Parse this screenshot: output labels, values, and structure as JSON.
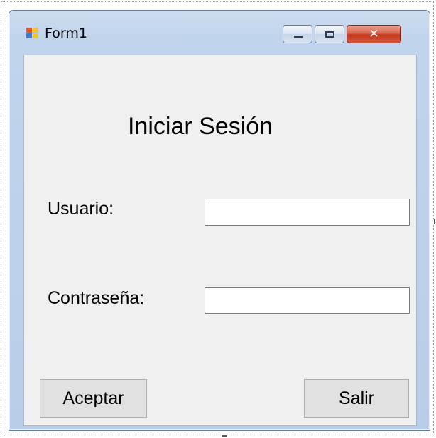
{
  "window": {
    "title": "Form1",
    "close_glyph": "✕"
  },
  "icons": {
    "app": "form-app-icon",
    "minimize": "minimize-icon",
    "maximize": "maximize-icon",
    "close": "close-icon"
  },
  "form": {
    "heading": "Iniciar Sesión",
    "username_label": "Usuario:",
    "username_value": "",
    "password_label": "Contraseña:",
    "password_value": "",
    "accept_label": "Aceptar",
    "exit_label": "Salir"
  },
  "colors": {
    "client_background": "#f0f0f0",
    "title_bar": "#c0d4ec",
    "close_button": "#c23a1f"
  }
}
